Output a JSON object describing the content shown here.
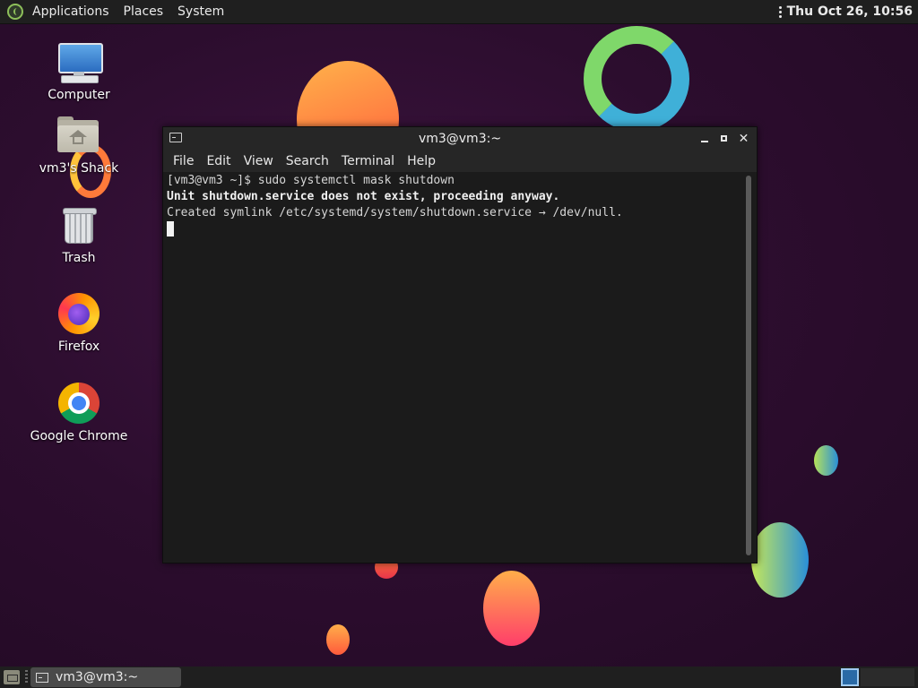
{
  "top_panel": {
    "applications": "Applications",
    "places": "Places",
    "system": "System",
    "clock": "Thu Oct 26, 10:56"
  },
  "desktop_icons": [
    {
      "label": "Computer",
      "icon": "computer-icon"
    },
    {
      "label": "vm3's Shack",
      "icon": "home-folder-icon"
    },
    {
      "label": "Trash",
      "icon": "trash-icon"
    },
    {
      "label": "Firefox",
      "icon": "firefox-icon"
    },
    {
      "label": "Google Chrome",
      "icon": "chrome-icon"
    }
  ],
  "terminal": {
    "title": "vm3@vm3:~",
    "menu": [
      "File",
      "Edit",
      "View",
      "Search",
      "Terminal",
      "Help"
    ],
    "lines": [
      "[vm3@vm3 ~]$ sudo systemctl mask shutdown",
      "Unit shutdown.service does not exist, proceeding anyway.",
      "Created symlink /etc/systemd/system/shutdown.service → /dev/null."
    ],
    "close_glyph": "✕"
  },
  "bottom_panel": {
    "task_label": "vm3@vm3:~"
  },
  "colors": {
    "panel": "#1f1f1f",
    "terminal_bg": "#1b1b1b",
    "wallpaper": "#2c0d2e",
    "workspace_active": "#2a6aa6"
  }
}
